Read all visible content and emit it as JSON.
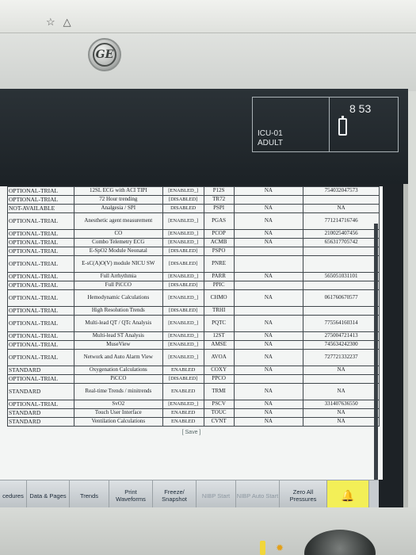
{
  "device": {
    "top_icons": [
      "☆",
      "△"
    ],
    "logo_text": "GE"
  },
  "header": {
    "unit": "ICU-01",
    "patient_type": "ADULT",
    "time": "8 53"
  },
  "table": {
    "rows": [
      {
        "type": "OPTIONAL-TRIAL",
        "feature": "12SL ECG with ACI TIPI",
        "status": "[ENABLED_]",
        "code": "P12S",
        "na": "NA",
        "serial": "754032047573"
      },
      {
        "type": "OPTIONAL-TRIAL",
        "feature": "72 Hour trending",
        "status": "[DISABLED]",
        "code": "TR72",
        "na": "",
        "serial": ""
      },
      {
        "type": "NOT-AVAILABLE",
        "feature": "Analgesia / SPI",
        "status": "DISABLED",
        "code": "PSPI",
        "na": "NA",
        "serial": "NA"
      },
      {
        "type": "OPTIONAL-TRIAL",
        "feature": "Anesthetic agent measurement",
        "status": "[ENABLED_]",
        "code": "PGAS",
        "na": "NA",
        "serial": "771214716746",
        "tall": true
      },
      {
        "type": "OPTIONAL-TRIAL",
        "feature": "CO",
        "status": "[ENABLED_]",
        "code": "PCOP",
        "na": "NA",
        "serial": "210025407456"
      },
      {
        "type": "OPTIONAL-TRIAL",
        "feature": "Combo Telemetry ECG",
        "status": "[ENABLED_]",
        "code": "ACMB",
        "na": "NA",
        "serial": "656317705742"
      },
      {
        "type": "OPTIONAL-TRIAL",
        "feature": "E-SpO2 Module Neonatal",
        "status": "[DISABLED]",
        "code": "PSPO",
        "na": "",
        "serial": ""
      },
      {
        "type": "OPTIONAL-TRIAL",
        "feature": "E-sC(A)O(V) module NICU SW",
        "status": "[DISABLED]",
        "code": "PNRE",
        "na": "",
        "serial": "",
        "tall": true
      },
      {
        "type": "OPTIONAL-TRIAL",
        "feature": "Full Arrhythmia",
        "status": "[ENABLED_]",
        "code": "PARR",
        "na": "NA",
        "serial": "565051031101"
      },
      {
        "type": "OPTIONAL-TRIAL",
        "feature": "Full PiCCO",
        "status": "[DISABLED]",
        "code": "PPIC",
        "na": "",
        "serial": ""
      },
      {
        "type": "OPTIONAL-TRIAL",
        "feature": "Hemodynamic Calculations",
        "status": "[ENABLED_]",
        "code": "CHMO",
        "na": "NA",
        "serial": "061760670577",
        "tall": true
      },
      {
        "type": "OPTIONAL-TRIAL",
        "feature": "High Resolution Trends",
        "status": "[DISABLED]",
        "code": "TRHI",
        "na": "",
        "serial": ""
      },
      {
        "type": "OPTIONAL-TRIAL",
        "feature": "Multi-lead QT / QTc Analysis",
        "status": "[ENABLED_]",
        "code": "PQTC",
        "na": "NA",
        "serial": "775564160314",
        "tall": true
      },
      {
        "type": "OPTIONAL-TRIAL",
        "feature": "Multi-lead ST Analysis",
        "status": "[ENABLED_]",
        "code": "12ST",
        "na": "NA",
        "serial": "275004721413"
      },
      {
        "type": "OPTIONAL-TRIAL",
        "feature": "MuseView",
        "status": "[ENABLED_]",
        "code": "AMSE",
        "na": "NA",
        "serial": "745634242300"
      },
      {
        "type": "OPTIONAL-TRIAL",
        "feature": "Network and Auto Alarm View",
        "status": "[ENABLED_]",
        "code": "AVOA",
        "na": "NA",
        "serial": "727721332237",
        "tall": true
      },
      {
        "type": "STANDARD",
        "feature": "Oxygenation Calculations",
        "status": "ENABLED",
        "code": "COXY",
        "na": "NA",
        "serial": "NA"
      },
      {
        "type": "OPTIONAL-TRIAL",
        "feature": "PiCCO",
        "status": "[DISABLED]",
        "code": "PPCO",
        "na": "",
        "serial": ""
      },
      {
        "type": "STANDARD",
        "feature": "Real-time Trends / minitrends",
        "status": "ENABLED",
        "code": "TRMI",
        "na": "NA",
        "serial": "NA",
        "tall": true
      },
      {
        "type": "OPTIONAL-TRIAL",
        "feature": "SvO2",
        "status": "[ENABLED_]",
        "code": "PSCV",
        "na": "NA",
        "serial": "331407636550"
      },
      {
        "type": "STANDARD",
        "feature": "Touch User Interface",
        "status": "ENABLED",
        "code": "TOUC",
        "na": "NA",
        "serial": "NA"
      },
      {
        "type": "STANDARD",
        "feature": "Ventilation Calculations",
        "status": "ENABLED",
        "code": "CVNT",
        "na": "NA",
        "serial": "NA"
      }
    ],
    "save_label": "[ Save ]"
  },
  "softkeys": [
    {
      "label": "cedures",
      "dim": false,
      "width": 34
    },
    {
      "label": "Data & Pages",
      "dim": false,
      "width": 54
    },
    {
      "label": "Trends",
      "dim": false,
      "width": 50
    },
    {
      "label": "Print Waveforms",
      "dim": false,
      "width": 55
    },
    {
      "label": "Freeze/ Snapshot",
      "dim": false,
      "width": 55
    },
    {
      "label": "NIBP Start",
      "dim": true,
      "width": 50
    },
    {
      "label": "NIBP Auto Start",
      "dim": true,
      "width": 55
    },
    {
      "label": "Zero All Pressures",
      "dim": false,
      "width": 60
    },
    {
      "label": "🔔",
      "alarm": true,
      "width": 53
    }
  ]
}
